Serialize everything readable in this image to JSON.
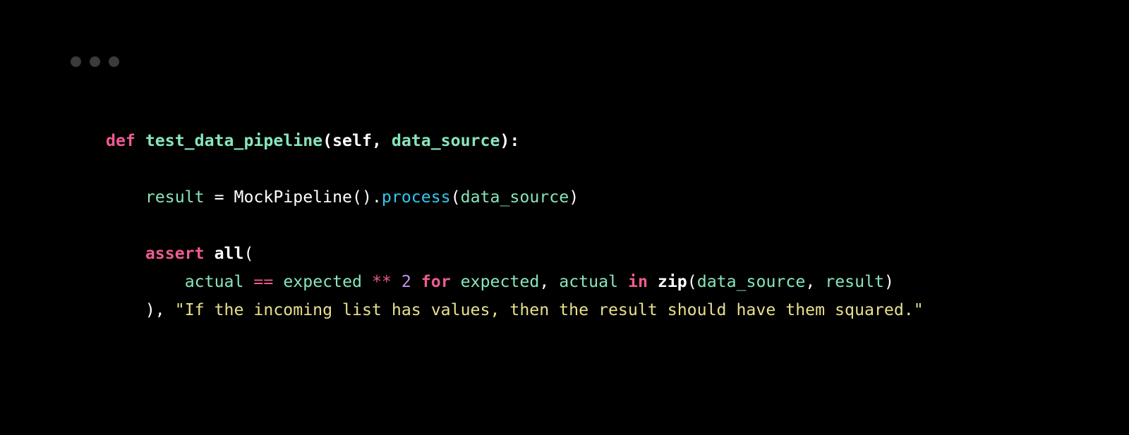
{
  "code": {
    "l1": {
      "def": "def ",
      "fname": "test_data_pipeline",
      "open": "(",
      "self": "self",
      "comma": ", ",
      "param": "data_source",
      "close": "):"
    },
    "l3": {
      "indent": "    ",
      "result": "result",
      "sp_eq_sp": " = ",
      "cls": "MockPipeline",
      "paren": "()",
      "dot": ".",
      "method": "process",
      "open": "(",
      "arg": "data_source",
      "close": ")"
    },
    "l5": {
      "indent": "    ",
      "assert": "assert ",
      "all": "all",
      "open": "("
    },
    "l6": {
      "indent": "        ",
      "actual": "actual",
      "sp1": " ",
      "eqeq": "==",
      "sp2": " ",
      "expected": "expected",
      "sp3": " ",
      "pow": "**",
      "sp4": " ",
      "two": "2",
      "sp5": " ",
      "for": "for",
      "sp6": " ",
      "expected2": "expected",
      "comma1": ", ",
      "actual2": "actual",
      "sp7": " ",
      "in": "in",
      "sp8": " ",
      "zip": "zip",
      "open": "(",
      "ds": "data_source",
      "comma2": ", ",
      "res": "result",
      "close": ")"
    },
    "l7": {
      "indent": "    ",
      "close": "), ",
      "msg": "\"If the incoming list has values, then the result should have them squared.\""
    }
  }
}
